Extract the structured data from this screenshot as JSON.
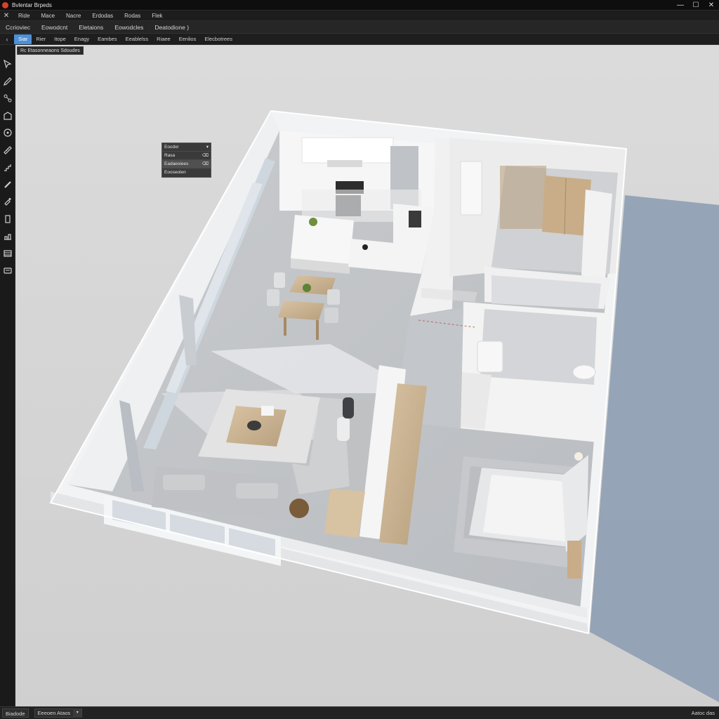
{
  "window": {
    "title": "Bvlentar Brpeds",
    "minimize": "—",
    "maximize": "☐",
    "close": "✕"
  },
  "menu": {
    "close": "✕",
    "items": [
      "Ride",
      "Mace",
      "Nacre",
      "Erdodas",
      "Rodas",
      "Flek"
    ]
  },
  "toolbar_row": {
    "items": [
      "Ccrioviec",
      "Eowodcnt",
      "Eletaions",
      "Eowodcles",
      "Deatodione )"
    ]
  },
  "tab_row": {
    "arrow": "‹",
    "tabs": [
      "Siar",
      "Rier",
      "Itope",
      "Enagy",
      "Eambes",
      "Eeablelss",
      "Riaee",
      "Eenlios",
      "Elecbotrees"
    ]
  },
  "viewport": {
    "label": "Rc Etasonneaons Sdoudes",
    "context_menu": [
      {
        "label": "Eocdor",
        "shortcut": "▾"
      },
      {
        "label": "Rasa",
        "shortcut": "⌫"
      },
      {
        "label": "Eadaeoiees",
        "shortcut": "⌫"
      },
      {
        "label": "Eooseolen",
        "shortcut": ""
      }
    ]
  },
  "statusbar": {
    "left": "Biadode",
    "select": "Eeeoen Ataos",
    "select_arrow": "▾",
    "right": "Aatoc das"
  },
  "colors": {
    "accent": "#4e8fd6",
    "logo": "#d8402b",
    "chrome": "#1d1d1d"
  }
}
